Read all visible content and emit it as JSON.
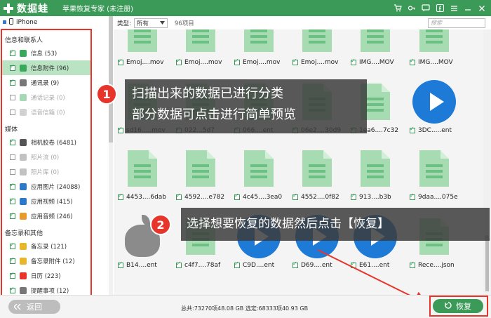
{
  "app": {
    "name": "数据蛙",
    "window_title": "苹果恢复专家 (未注册)"
  },
  "device": {
    "label": "iPhone"
  },
  "sidebar": {
    "sections": [
      {
        "title": "信息和联系人",
        "items": [
          {
            "label": "信息 (53)",
            "checked": true,
            "icon_color": "#3aa85a",
            "active": false,
            "dim": false
          },
          {
            "label": "信息附件 (96)",
            "checked": true,
            "icon_color": "#3aa85a",
            "active": true,
            "dim": false
          },
          {
            "label": "通讯录 (9)",
            "checked": true,
            "icon_color": "#777777",
            "active": false,
            "dim": false
          },
          {
            "label": "通话记录 (0)",
            "checked": false,
            "icon_color": "#3aa85a",
            "active": false,
            "dim": true
          },
          {
            "label": "语音信箱 (0)",
            "checked": false,
            "icon_color": "#999999",
            "active": false,
            "dim": true
          }
        ]
      },
      {
        "title": "媒体",
        "items": [
          {
            "label": "相机胶卷 (6481)",
            "checked": true,
            "icon_color": "#555555",
            "active": false,
            "dim": false
          },
          {
            "label": "照片流 (0)",
            "checked": false,
            "icon_color": "#777777",
            "active": false,
            "dim": true
          },
          {
            "label": "照片库 (0)",
            "checked": false,
            "icon_color": "#777777",
            "active": false,
            "dim": true
          },
          {
            "label": "应用图片 (24088)",
            "checked": true,
            "icon_color": "#2c78c9",
            "active": false,
            "dim": false
          },
          {
            "label": "应用视频 (415)",
            "checked": true,
            "icon_color": "#2c78c9",
            "active": false,
            "dim": false
          },
          {
            "label": "应用音频 (246)",
            "checked": true,
            "icon_color": "#e89a2b",
            "active": false,
            "dim": false
          }
        ]
      },
      {
        "title": "备忘录和其他",
        "items": [
          {
            "label": "备忘录 (121)",
            "checked": true,
            "icon_color": "#e8b62b",
            "active": false,
            "dim": false
          },
          {
            "label": "备忘录附件 (12)",
            "checked": true,
            "icon_color": "#e8b62b",
            "active": false,
            "dim": false
          },
          {
            "label": "日历 (223)",
            "checked": true,
            "icon_color": "#e8352b",
            "active": false,
            "dim": false
          },
          {
            "label": "提醒事项 (12)",
            "checked": true,
            "icon_color": "#777777",
            "active": false,
            "dim": false
          }
        ]
      }
    ]
  },
  "filter": {
    "type_label": "类型:",
    "type_value": "所有",
    "item_count": "96项目",
    "search_placeholder": "搜索"
  },
  "grid": {
    "rows": [
      [
        {
          "name": "Emoj....mov",
          "kind": "doc"
        },
        {
          "name": "Emoj....mov",
          "kind": "doc"
        },
        {
          "name": "Emoj....mov",
          "kind": "doc"
        },
        {
          "name": "Emoj....mov",
          "kind": "doc"
        },
        {
          "name": "IMG....MOV",
          "kind": "doc"
        },
        {
          "name": "IMG....MOV",
          "kind": "doc"
        }
      ],
      [
        {
          "name": "sd16.....mov",
          "kind": "doc"
        },
        {
          "name": "022...5d7",
          "kind": "doc"
        },
        {
          "name": "066....ent",
          "kind": "doc"
        },
        {
          "name": "06e2....30d9",
          "kind": "doc"
        },
        {
          "name": "1ea6....7c32",
          "kind": "doc"
        },
        {
          "name": "3DC.....ent",
          "kind": "play"
        }
      ],
      [
        {
          "name": "4453....6dab",
          "kind": "doc"
        },
        {
          "name": "4592....e782",
          "kind": "doc"
        },
        {
          "name": "4c45....3ea0",
          "kind": "doc"
        },
        {
          "name": "4552....0f82",
          "kind": "doc"
        },
        {
          "name": "913....b3b",
          "kind": "doc"
        },
        {
          "name": "9daa....075e",
          "kind": "doc"
        }
      ],
      [
        {
          "name": "B14....ent",
          "kind": "apple"
        },
        {
          "name": "c4f7....78af",
          "kind": "doc"
        },
        {
          "name": "C9D....ent",
          "kind": "play"
        },
        {
          "name": "D69....ent",
          "kind": "play"
        },
        {
          "name": "E61....ent",
          "kind": "play"
        },
        {
          "name": "Rece....json",
          "kind": "doc"
        }
      ]
    ]
  },
  "annotations": {
    "callout1_badge": "1",
    "callout1_line1": "扫描出来的数据已进行分类",
    "callout1_line2": "部分数据可点击进行简单预览",
    "callout2_badge": "2",
    "callout2_text": "选择想要恢复的数据然后点击【恢复】"
  },
  "footer": {
    "back_label": "返回",
    "status": "总共:73270项48.08 GB 选定:68333项40.93 GB",
    "recover_label": "恢复"
  },
  "colors": {
    "brand": "#3c9a58",
    "highlight_red": "#e8352b",
    "video_blue": "#1d7ad6",
    "doc_green": "#a7dbb2"
  }
}
